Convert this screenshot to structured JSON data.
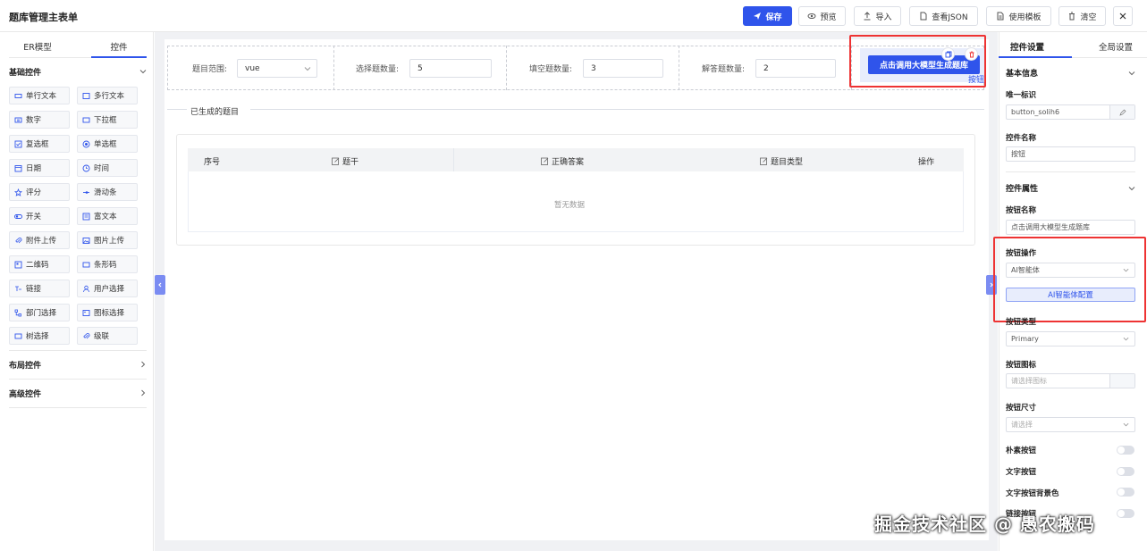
{
  "app": {
    "title": "题库管理主表单"
  },
  "toolbar": {
    "save": "保存",
    "preview": "预览",
    "import": "导入",
    "view_json": "查看JSON",
    "use_template": "使用模板",
    "clear": "清空"
  },
  "left_panel": {
    "tabs": [
      "ER模型",
      "控件"
    ],
    "basic_section": "基础控件",
    "layout_section": "布局控件",
    "advanced_section": "高级控件",
    "components": [
      "单行文本",
      "多行文本",
      "数字",
      "下拉框",
      "复选框",
      "单选框",
      "日期",
      "时间",
      "评分",
      "滑动条",
      "开关",
      "富文本",
      "附件上传",
      "图片上传",
      "二维码",
      "条形码",
      "链接",
      "用户选择",
      "部门选择",
      "图标选择",
      "树选择",
      "级联"
    ]
  },
  "form": {
    "range_label": "题目范围:",
    "range_value": "vue",
    "choice_label": "选择题数量:",
    "choice_value": "5",
    "fill_label": "填空题数量:",
    "fill_value": "3",
    "answer_label": "解答题数量:",
    "answer_value": "2",
    "gen_button": "点击调用大模型生成题库",
    "button_tag": "按钮",
    "generated_title": "已生成的题目",
    "columns": [
      "序号",
      "题干",
      "正确答案",
      "题目类型",
      "操作"
    ],
    "empty_text": "暂无数据"
  },
  "right_panel": {
    "tabs": [
      "控件设置",
      "全局设置"
    ],
    "basic_info": "基本信息",
    "id_label": "唯一标识",
    "id_value": "button_solih6",
    "name_label": "控件名称",
    "name_value": "按钮",
    "props_section": "控件属性",
    "btn_name_label": "按钮名称",
    "btn_name_value": "点击调用大模型生成题库",
    "btn_action_label": "按钮操作",
    "btn_action_value": "AI智能体",
    "ai_config": "AI智能体配置",
    "btn_type_label": "按钮类型",
    "btn_type_value": "Primary",
    "btn_icon_label": "按钮图标",
    "btn_icon_placeholder": "请选择图标",
    "btn_size_label": "按钮尺寸",
    "btn_size_placeholder": "请选择",
    "plain_label": "朴素按钮",
    "text_btn_label": "文字按钮",
    "text_bg_label": "文字按钮背景色",
    "link_label": "链接按钮"
  },
  "watermark": "掘金技术社区 @ 愚农搬码",
  "colors": {
    "primary": "#2f54eb",
    "highlight": "#ee3333"
  }
}
